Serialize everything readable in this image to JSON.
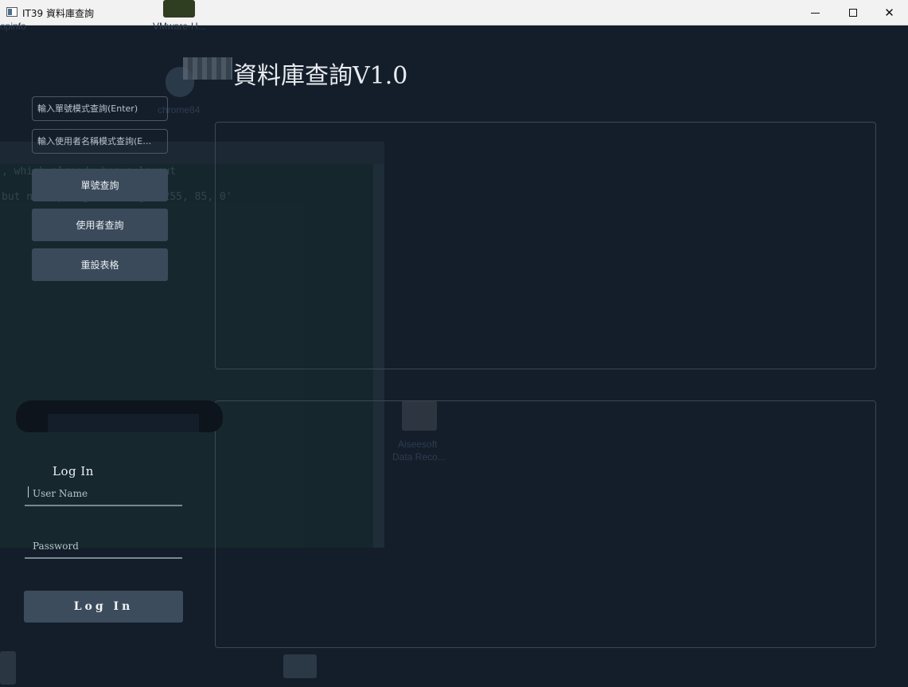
{
  "window": {
    "title": "IT39 資料庫查詢",
    "minimize_icon": "minimize-icon",
    "maximize_icon": "maximize-icon",
    "close_icon": "close-icon",
    "close_glyph": "✕"
  },
  "header": {
    "title": "資料庫查詢V1.0"
  },
  "query": {
    "order_placeholder": "輸入單號模式查詢(Enter)",
    "user_placeholder": "輸入使用者名稱模式查詢(E…",
    "order_button": "單號查詢",
    "user_button": "使用者查詢",
    "reset_button": "重設表格"
  },
  "login": {
    "title": "Log In",
    "username_placeholder": "User Name",
    "password_placeholder": "Password",
    "button": "Log In"
  },
  "background": {
    "desktop_labels": [
      "opinfo",
      "VMware-H...",
      "chrome84",
      "Aiseesoft",
      "Data Reco..."
    ],
    "console_lines": [
      ", which already has a layout",
      "but no alpha given: 'rgba 255, 85, 0'"
    ]
  },
  "colors": {
    "background": "#141e2b",
    "button": "#3b4a5a",
    "panel_border": "#3a4756",
    "titlebar": "#f2f2f2"
  }
}
